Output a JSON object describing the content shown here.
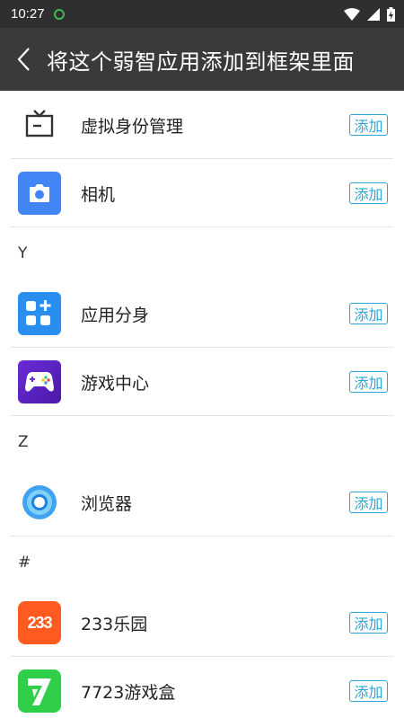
{
  "status": {
    "time": "10:27"
  },
  "toolbar": {
    "title": "将这个弱智应用添加到框架里面"
  },
  "apps_top": [
    {
      "name": "虚拟身份管理",
      "icon": "tv-icon",
      "add": "添加"
    },
    {
      "name": "相机",
      "icon": "camera-icon",
      "add": "添加"
    }
  ],
  "section_y": "Y",
  "apps_y": [
    {
      "name": "应用分身",
      "icon": "app-clone-icon",
      "add": "添加"
    },
    {
      "name": "游戏中心",
      "icon": "gamepad-icon",
      "add": "添加"
    }
  ],
  "section_z": "Z",
  "apps_z": [
    {
      "name": "浏览器",
      "icon": "browser-icon",
      "add": "添加"
    }
  ],
  "section_hash": "#",
  "apps_hash": [
    {
      "name": "233乐园",
      "icon": "233-icon",
      "icon_text": "233",
      "add": "添加"
    },
    {
      "name": "7723游戏盒",
      "icon": "7723-icon",
      "add": "添加"
    }
  ],
  "colors": {
    "accent": "#2ca6d8",
    "toolbar": "#3a3a3a",
    "statusbar": "#2f2f2f"
  }
}
